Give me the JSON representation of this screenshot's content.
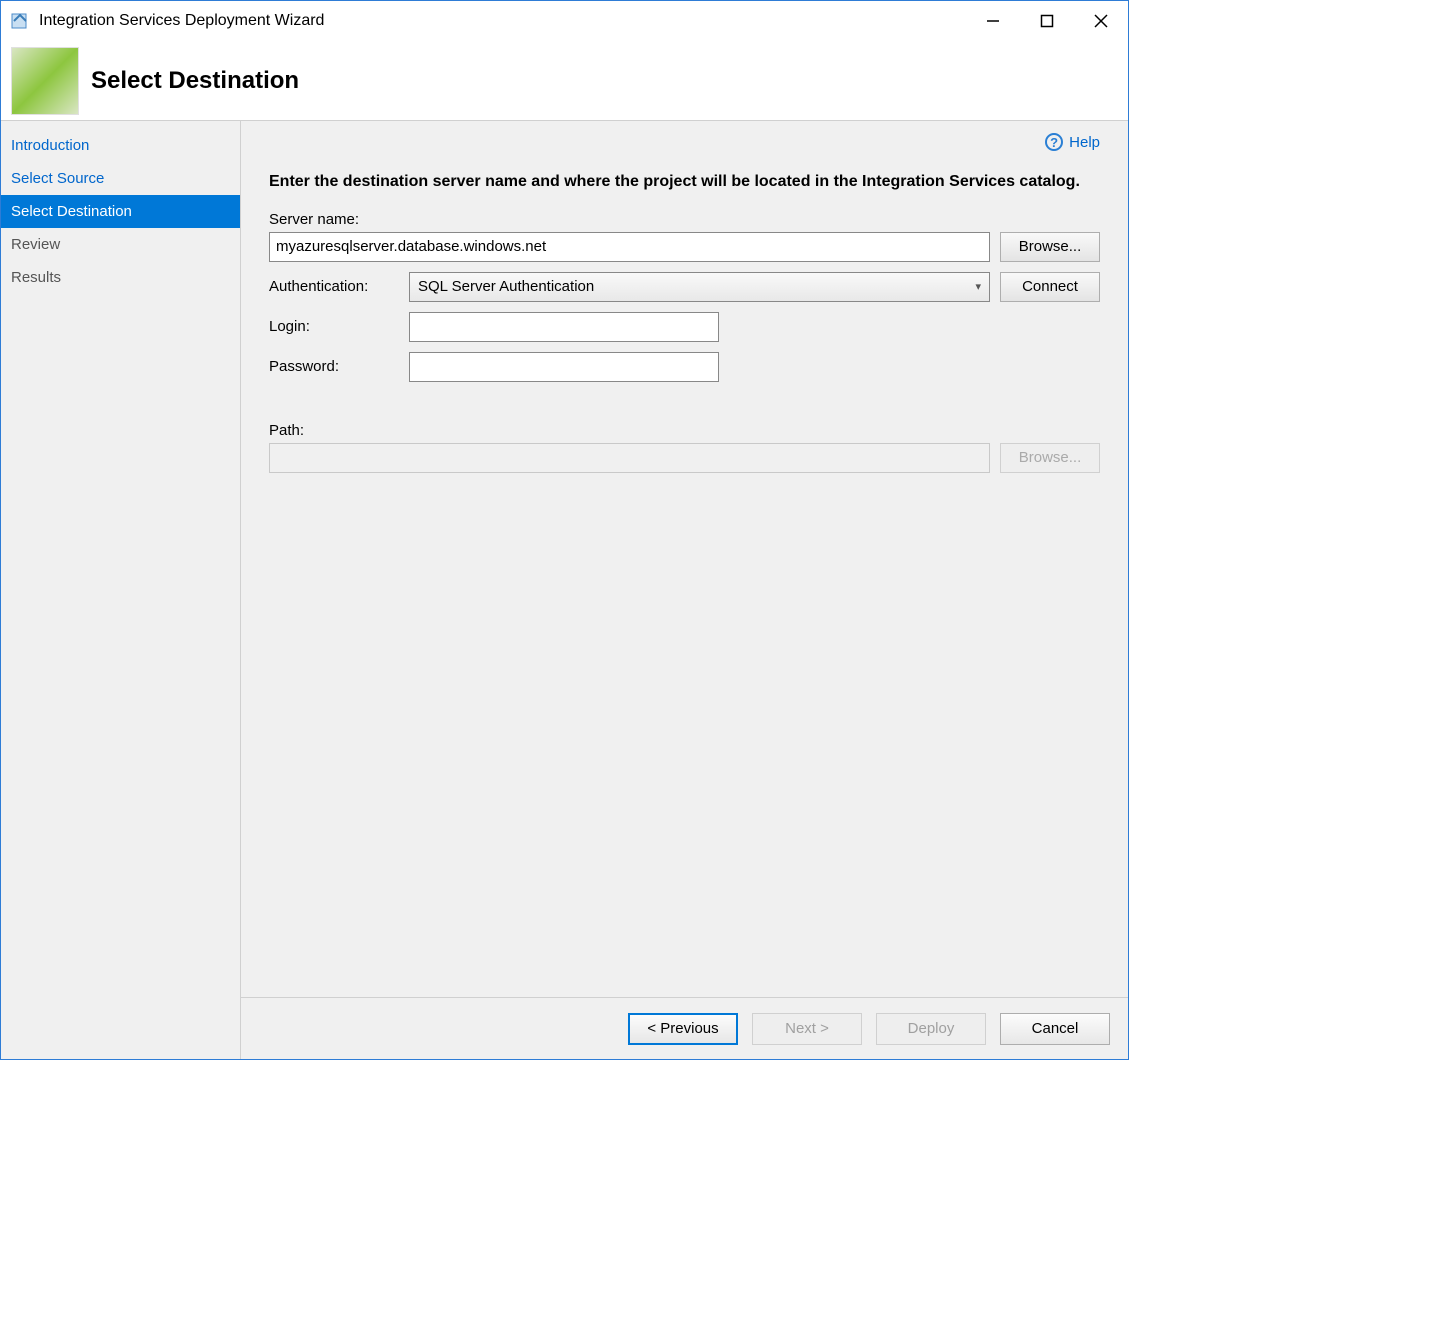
{
  "window": {
    "title": "Integration Services Deployment Wizard"
  },
  "header": {
    "title": "Select Destination"
  },
  "sidebar": {
    "items": [
      {
        "label": "Introduction",
        "state": "link"
      },
      {
        "label": "Select Source",
        "state": "link"
      },
      {
        "label": "Select Destination",
        "state": "active"
      },
      {
        "label": "Review",
        "state": "disabled"
      },
      {
        "label": "Results",
        "state": "disabled"
      }
    ]
  },
  "main": {
    "help_label": "Help",
    "instruction": "Enter the destination server name and where the project will be located in the Integration Services catalog.",
    "server_name_label": "Server name:",
    "server_name_value": "myazuresqlserver.database.windows.net",
    "browse_label": "Browse...",
    "authentication_label": "Authentication:",
    "authentication_value": "SQL Server Authentication",
    "connect_label": "Connect",
    "login_label": "Login:",
    "login_value": "",
    "password_label": "Password:",
    "password_value": "",
    "path_label": "Path:",
    "path_value": "",
    "browse2_label": "Browse..."
  },
  "footer": {
    "previous": "< Previous",
    "next": "Next >",
    "deploy": "Deploy",
    "cancel": "Cancel"
  }
}
